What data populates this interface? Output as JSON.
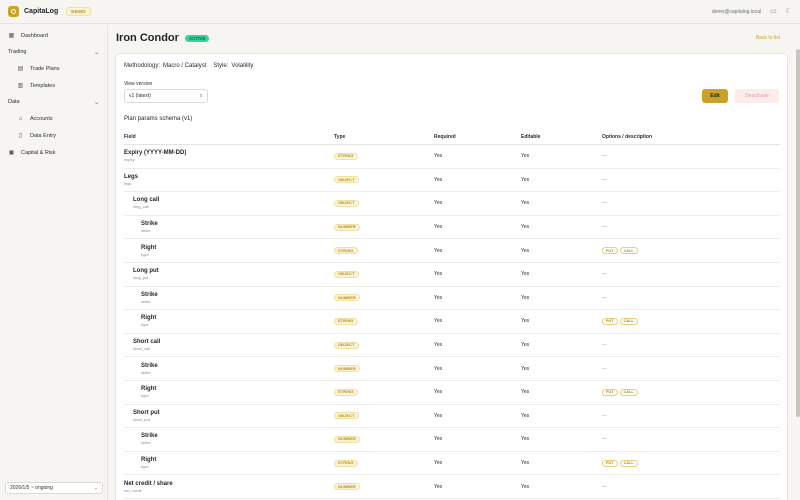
{
  "topbar": {
    "brand": "CapitaLog",
    "demo_badge": "DEMO",
    "user_email": "demo@capitalog.local",
    "icons": [
      "monitor-icon",
      "moon-icon"
    ]
  },
  "sidebar": {
    "items": [
      {
        "label": "Dashboard",
        "icon": "grid-icon"
      },
      {
        "section": "Trading"
      },
      {
        "label": "Trade Plans",
        "icon": "calendar-icon"
      },
      {
        "label": "Templates",
        "icon": "template-icon"
      },
      {
        "section": "Data"
      },
      {
        "label": "Accounts",
        "icon": "bank-icon"
      },
      {
        "label": "Data Entry",
        "icon": "file-icon"
      },
      {
        "label": "Capital & Risk",
        "icon": "wallet-icon"
      }
    ],
    "period": "2026/1/5 ~ ongoing"
  },
  "header": {
    "title": "Iron Condor",
    "status": "ACTIVE",
    "back_link": "Back to list"
  },
  "meta": {
    "methodology_label": "Methodology:",
    "methodology_value": "Macro / Catalyst",
    "style_label": "Style:",
    "style_value": "Volatility"
  },
  "version": {
    "label": "View version",
    "selected": "v1 (latest)"
  },
  "actions": {
    "edit": "Edit",
    "deactivate": "Deactivate"
  },
  "schema": {
    "title": "Plan params schema (v1)",
    "columns": [
      "Field",
      "Type",
      "Required",
      "Editable",
      "Options / description"
    ],
    "rows": [
      {
        "label": "Expiry (YYYY-MM-DD)",
        "key": "expiry",
        "type": "STRING",
        "required": "Yes",
        "editable": "Yes",
        "options": "—"
      },
      {
        "label": "Legs",
        "key": "legs",
        "type": "OBJECT",
        "required": "Yes",
        "editable": "Yes",
        "options": "—"
      },
      {
        "label": "Long call",
        "key": "long_call",
        "type": "OBJECT",
        "required": "Yes",
        "editable": "Yes",
        "options": "—"
      },
      {
        "label": "Strike",
        "key": "strike",
        "type": "NUMBER",
        "required": "Yes",
        "editable": "Yes",
        "options": "—"
      },
      {
        "label": "Right",
        "key": "type",
        "type": "STRING",
        "required": "Yes",
        "editable": "Yes",
        "options": [
          "PUT",
          "CALL"
        ]
      },
      {
        "label": "Long put",
        "key": "long_put",
        "type": "OBJECT",
        "required": "Yes",
        "editable": "Yes",
        "options": "—"
      },
      {
        "label": "Strike",
        "key": "strike",
        "type": "NUMBER",
        "required": "Yes",
        "editable": "Yes",
        "options": "—"
      },
      {
        "label": "Right",
        "key": "type",
        "type": "STRING",
        "required": "Yes",
        "editable": "Yes",
        "options": [
          "PUT",
          "CALL"
        ]
      },
      {
        "label": "Short call",
        "key": "short_call",
        "type": "OBJECT",
        "required": "Yes",
        "editable": "Yes",
        "options": "—"
      },
      {
        "label": "Strike",
        "key": "strike",
        "type": "NUMBER",
        "required": "Yes",
        "editable": "Yes",
        "options": "—"
      },
      {
        "label": "Right",
        "key": "type",
        "type": "STRING",
        "required": "Yes",
        "editable": "Yes",
        "options": [
          "PUT",
          "CALL"
        ]
      },
      {
        "label": "Short put",
        "key": "short_put",
        "type": "OBJECT",
        "required": "Yes",
        "editable": "Yes",
        "options": "—"
      },
      {
        "label": "Strike",
        "key": "strike",
        "type": "NUMBER",
        "required": "Yes",
        "editable": "Yes",
        "options": "—"
      },
      {
        "label": "Right",
        "key": "type",
        "type": "STRING",
        "required": "Yes",
        "editable": "Yes",
        "options": [
          "PUT",
          "CALL"
        ]
      },
      {
        "label": "Net credit / share",
        "key": "net_credit",
        "type": "NUMBER",
        "required": "Yes",
        "editable": "Yes",
        "options": "—"
      }
    ]
  },
  "colors": {
    "accent": "#c9a227",
    "active": "#34d399",
    "danger_light": "#fdecec"
  }
}
